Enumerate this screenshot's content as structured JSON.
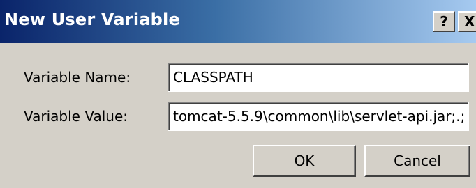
{
  "window": {
    "title": "New User Variable",
    "help_label": "?",
    "close_label": "X"
  },
  "form": {
    "name_label": "Variable Name:",
    "name_value": "CLASSPATH",
    "value_label": "Variable Value:",
    "value_value": "tomcat-5.5.9\\common\\lib\\servlet-api.jar;.;"
  },
  "buttons": {
    "ok_label": "OK",
    "cancel_label": "Cancel"
  }
}
